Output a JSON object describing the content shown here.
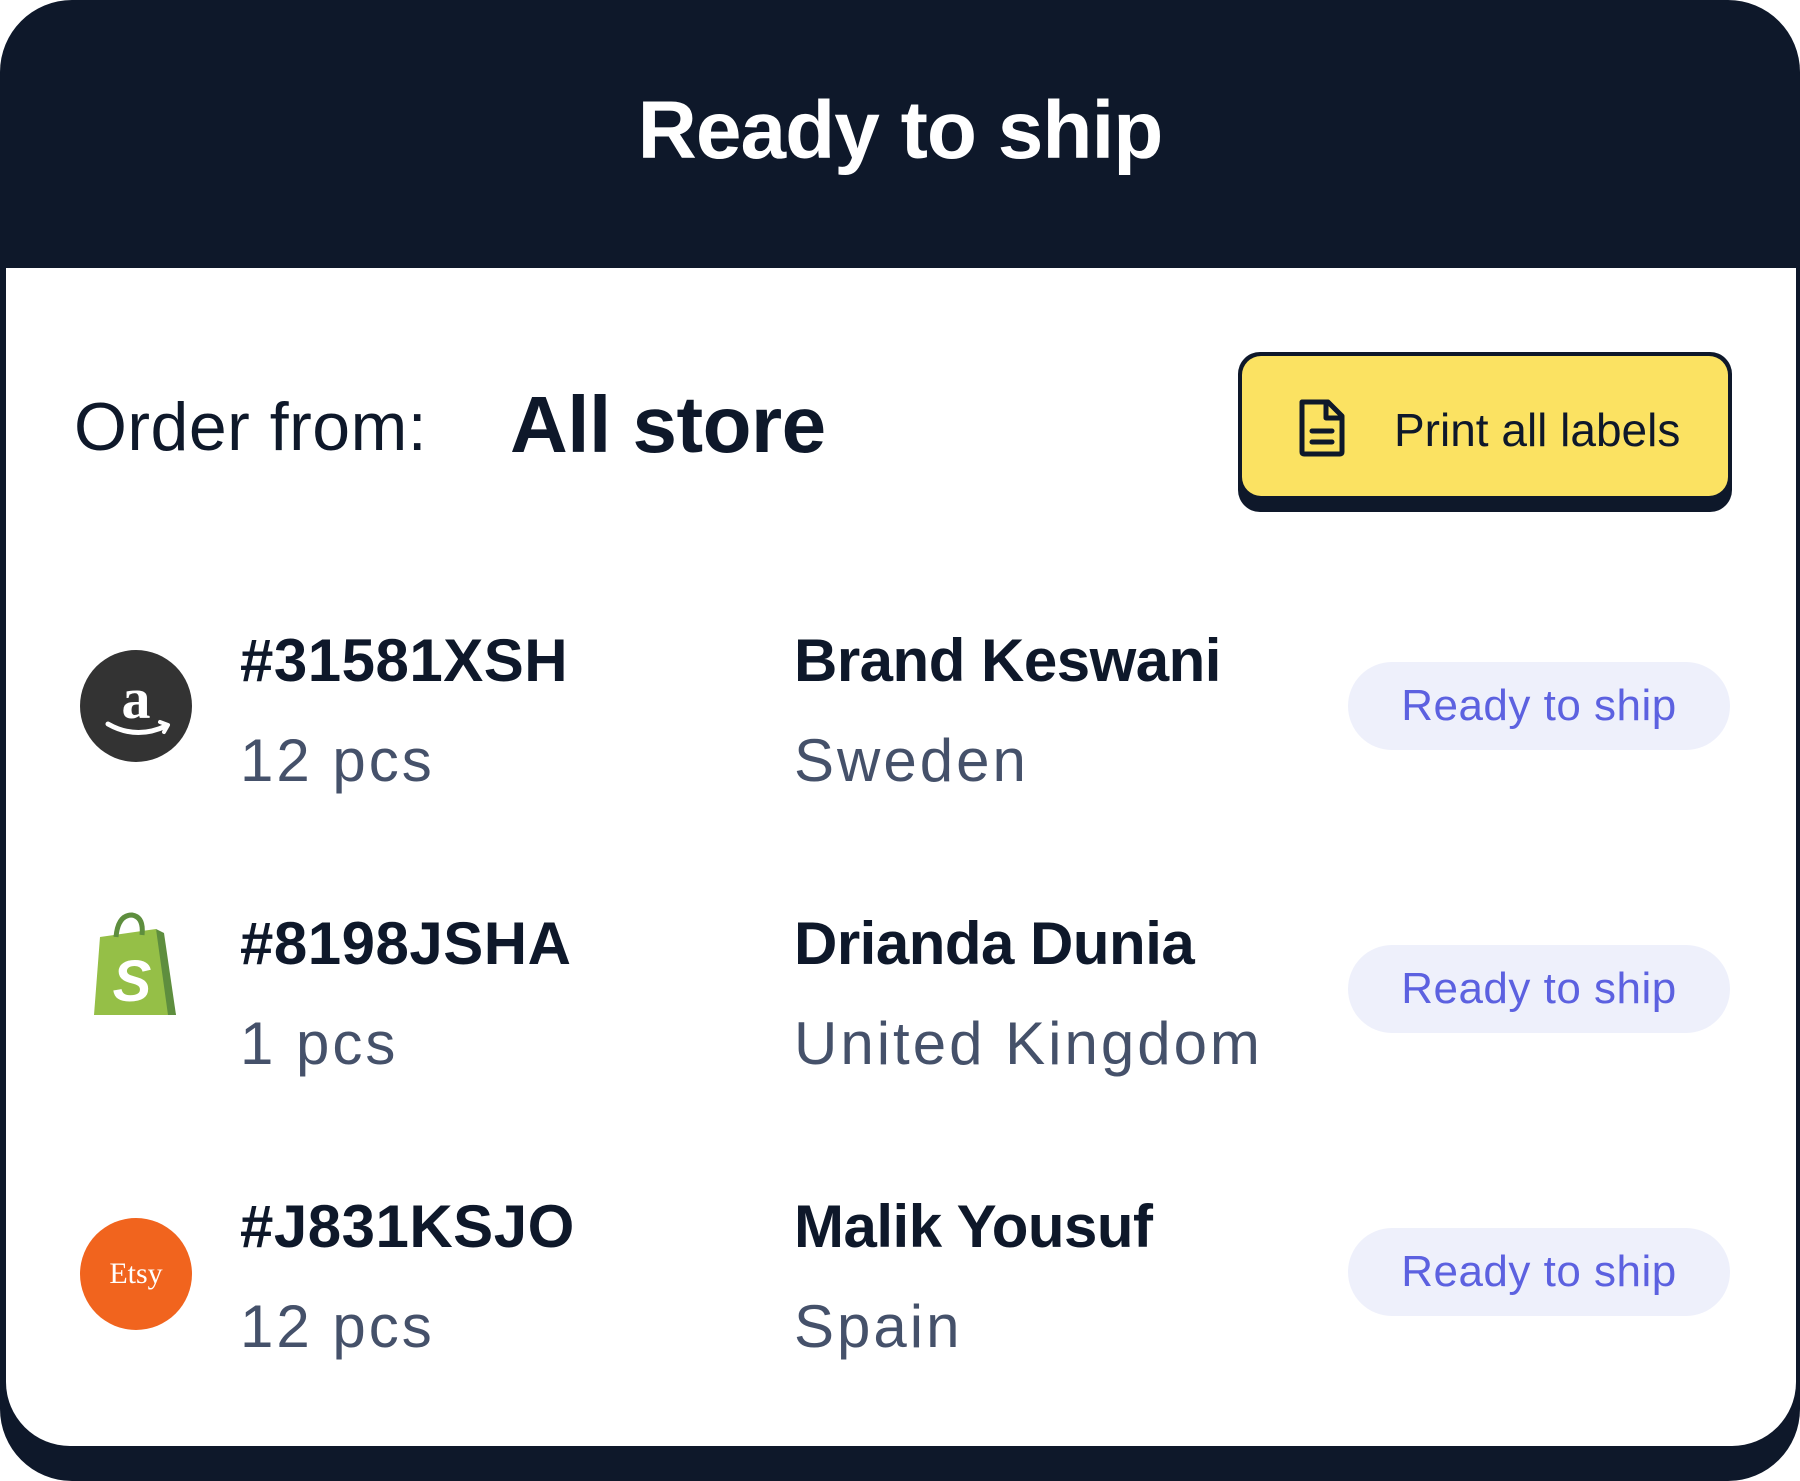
{
  "header": {
    "title": "Ready to ship"
  },
  "filter": {
    "label": "Order from:",
    "value": "All store"
  },
  "actions": {
    "print_label": "Print all labels",
    "print_icon": "document-icon"
  },
  "orders": [
    {
      "store": "amazon",
      "store_icon": "amazon-logo-icon",
      "id": "#31581XSH",
      "qty": "12 pcs",
      "customer": "Brand Keswani",
      "country": "Sweden",
      "status": "Ready to ship"
    },
    {
      "store": "shopify",
      "store_icon": "shopify-logo-icon",
      "id": "#8198JSHA",
      "qty": "1 pcs",
      "customer": "Drianda Dunia",
      "country": "United Kingdom",
      "status": "Ready to ship"
    },
    {
      "store": "etsy",
      "store_icon": "etsy-logo-icon",
      "logo_text": "Etsy",
      "id": "#J831KSJO",
      "qty": "12 pcs",
      "customer": "Malik Yousuf",
      "country": "Spain",
      "status": "Ready to ship"
    }
  ],
  "colors": {
    "frame": "#0e182a",
    "button": "#fbe262",
    "badge_bg": "#eef0fb",
    "badge_text": "#5c61e0",
    "muted_text": "#45516a",
    "etsy": "#f1641e",
    "shopify": "#95bf47",
    "amazon": "#333333"
  }
}
